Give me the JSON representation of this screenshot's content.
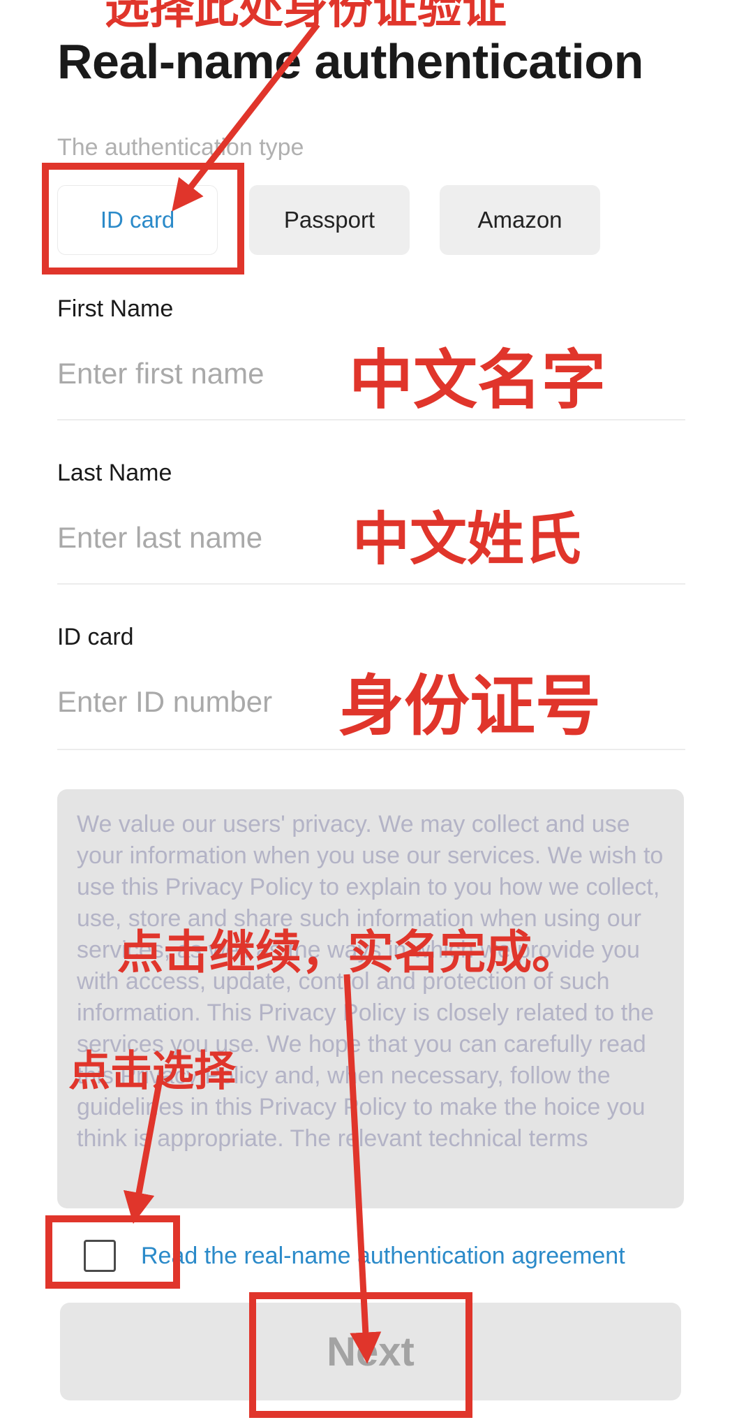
{
  "header": {
    "title": "Real-name authentication"
  },
  "auth_type": {
    "caption": "The authentication type",
    "options": [
      {
        "label": "ID card",
        "selected": true
      },
      {
        "label": "Passport",
        "selected": false
      },
      {
        "label": "Amazon",
        "selected": false
      }
    ]
  },
  "fields": {
    "first_name": {
      "label": "First Name",
      "placeholder": "Enter first name",
      "value": ""
    },
    "last_name": {
      "label": "Last Name",
      "placeholder": "Enter last name",
      "value": ""
    },
    "id_number": {
      "label": "ID card",
      "placeholder": "Enter ID number",
      "value": ""
    }
  },
  "policy": {
    "text": "We value our users' privacy. We may collect and use your information when you use our services. We wish to use this Privacy Policy to explain to you how we collect, use, store and share such information when using our services, as well as the ways in which we provide you with access, update, control and protection of such information. This Privacy Policy is closely related to the services you use. We hope that you can carefully read this Privacy Policy and, when necessary, follow the guidelines in this Privacy Policy to make the hoice you think is appropriate. The relevant technical terms"
  },
  "agreement": {
    "label": "Read the real-name authentication agreement",
    "checked": false
  },
  "actions": {
    "next_label": "Next"
  },
  "annotations": {
    "top": "选择此处身份证验证",
    "first_name": "中文名字",
    "last_name": "中文姓氏",
    "id_number": "身份证号",
    "next": "点击继续，实名完成。",
    "select": "点击选择"
  },
  "colors": {
    "accent": "#2b8ac9",
    "annotation": "#e0352b",
    "button_disabled": "#e6e6e6"
  }
}
